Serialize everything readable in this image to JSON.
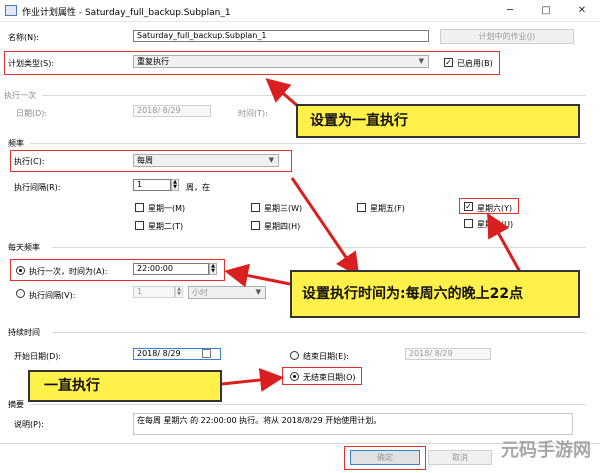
{
  "window": {
    "title": "作业计划属性 - Saturday_full_backup.Subplan_1",
    "minimize": "─",
    "maximize": "□",
    "close": "✕"
  },
  "name": {
    "label": "名称(N):",
    "value": "Saturday_full_backup.Subplan_1",
    "jobs_button": "计划中的作业(J)"
  },
  "schedule_type": {
    "label": "计划类型(S):",
    "value": "重复执行",
    "enabled_label": "已启用(B)",
    "enabled": true
  },
  "once": {
    "group": "执行一次",
    "date_label": "日期(D):",
    "date_value": "2018/ 8/29",
    "time_label": "时间(T):"
  },
  "frequency": {
    "group": "频率",
    "occurs_label": "执行(C):",
    "occurs_value": "每周",
    "recur_label": "执行间隔(R):",
    "recur_value": "1",
    "recur_suffix": "周，在",
    "days": {
      "mon": "星期一(M)",
      "tue": "星期二(T)",
      "wed": "星期三(W)",
      "thu": "星期四(H)",
      "fri": "星期五(F)",
      "sat": "星期六(Y)",
      "sun": "星期日(U)"
    },
    "sat_checked": true
  },
  "daily": {
    "group": "每天频率",
    "once_label": "执行一次，时间为(A):",
    "once_value": "22:00:00",
    "every_label": "执行间隔(V):",
    "every_value": "1",
    "every_unit": "小时"
  },
  "duration": {
    "group": "持续时间",
    "start_label": "开始日期(D):",
    "start_value": "2018/ 8/29",
    "end_label": "结束日期(E):",
    "end_value": "2018/ 8/29",
    "noend_label": "无结束日期(O)"
  },
  "summary": {
    "group": "摘要",
    "desc_label": "说明(P):",
    "desc_value": "在每周 星期六 的 22:00:00 执行。将从 2018/8/29 开始使用计划。"
  },
  "buttons": {
    "ok": "确定",
    "cancel": "取消"
  },
  "callouts": {
    "c1": "设置为一直执行",
    "c2": "设置执行时间为:每周六的晚上22点",
    "c3": "一直执行"
  },
  "watermark": "元码手游网",
  "colors": {
    "callout_fill": "#fff04a",
    "arrow_red": "#d91f1f",
    "highlight_red": "#e03030"
  }
}
